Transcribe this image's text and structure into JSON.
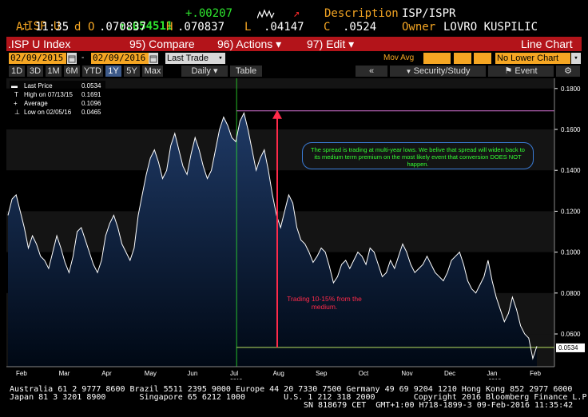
{
  "header": {
    "ticker": ".ISP U",
    "arrow_up": "↑",
    "last": ".054511",
    "change": "+.00207",
    "description_label": "Description",
    "description_value": "ISP/ISPR",
    "at_label": "At",
    "time": "11:35",
    "d_label": "d",
    "open_label": "O",
    "open": ".070837",
    "high_label": "H",
    "high": ".070837",
    "low_label": "L",
    "low": ".04147",
    "close_label": "C",
    "close": ".0524",
    "owner_label": "Owner",
    "owner": "LOVRO KUSPILIC"
  },
  "toolbar": {
    "index_label": ".ISP U Index",
    "compare": "95) Compare",
    "actions": "96) Actions ▾",
    "edit": "97) Edit ▾",
    "chart_type": "Line Chart"
  },
  "controls": {
    "start_date": "02/09/2015",
    "end_date": "02/09/2016",
    "dash": "-",
    "field": "Last Trade",
    "mov_avg": "Mov Avg",
    "lower_chart": "No Lower Chart",
    "periods": [
      "1D",
      "3D",
      "1M",
      "6M",
      "YTD",
      "1Y",
      "5Y",
      "Max"
    ],
    "selected_period": "1Y",
    "frequency": "Daily ▾",
    "table": "Table",
    "security_study": "Security/Study",
    "event": "Event",
    "back_icon": "«"
  },
  "legend": {
    "last_price_label": "Last Price",
    "last_price": "0.0534",
    "high_label": "High on 07/13/15",
    "high": "0.1691",
    "average_label": "Average",
    "average": "0.1096",
    "low_label": "Low on 02/05/16",
    "low": "0.0465"
  },
  "annotations": {
    "comment": "The spread is trading at multi-year lows. We belive that spread will widen back to its medium term  premium on the most likely event that conversion DOES NOT happen.",
    "arrow_note": "Trading 10-15% from the medium."
  },
  "footer": {
    "line1": "Australia 61 2 9777 8600 Brazil 5511 2395 9000 Europe 44 20 7330 7500 Germany 49 69 9204 1210 Hong Kong 852 2977 6000",
    "line2": "Japan 81 3 3201 8900       Singapore 65 6212 1000        U.S. 1 212 318 2000        Copyright 2016 Bloomberg Finance L.P.",
    "line3": "SN 818679 CET  GMT+1:00 H718-1899-3 09-Feb-2016 11:35:42"
  },
  "colors": {
    "accent_orange": "#f5a623",
    "toolbar_red": "#b3141a",
    "line": "#ffffff",
    "area_top": "#1f3a66",
    "reference_high": "#d070d0",
    "reference_low": "#b8e060",
    "arrow": "#ff2a4a",
    "comment_text": "#33ff33"
  },
  "chart_data": {
    "type": "area",
    "ylim": [
      0.044,
      0.185
    ],
    "yticks": [
      0.06,
      0.08,
      0.1,
      0.12,
      0.14,
      0.16,
      0.18
    ],
    "ytick_labels": [
      "0.0600",
      "0.0800",
      "0.1000",
      "0.1200",
      "0.1400",
      "0.1600",
      "0.1800"
    ],
    "last_value_label": "0.0534",
    "xtick_labels": [
      "Feb",
      "Mar",
      "Apr",
      "May",
      "Jun",
      "Jul",
      "Aug",
      "Sep",
      "Oct",
      "Nov",
      "Dec",
      "Jan",
      "Feb"
    ],
    "year_labels": [
      "2015",
      "2016"
    ],
    "high_line": 0.1691,
    "low_line": 0.0534,
    "series": [
      {
        "values": [
          0.118,
          0.126,
          0.128,
          0.12,
          0.112,
          0.102,
          0.108,
          0.104,
          0.098,
          0.096,
          0.092,
          0.1,
          0.108,
          0.102,
          0.095,
          0.09,
          0.098,
          0.11,
          0.112,
          0.106,
          0.1,
          0.094,
          0.09,
          0.096,
          0.108,
          0.114,
          0.118,
          0.112,
          0.104,
          0.1,
          0.096,
          0.102,
          0.118,
          0.128,
          0.138,
          0.146,
          0.15,
          0.144,
          0.136,
          0.14,
          0.152,
          0.158,
          0.15,
          0.142,
          0.138,
          0.148,
          0.156,
          0.15,
          0.142,
          0.136,
          0.14,
          0.15,
          0.16,
          0.166,
          0.162,
          0.156,
          0.154,
          0.164,
          0.168,
          0.16,
          0.15,
          0.14,
          0.146,
          0.15,
          0.14,
          0.128,
          0.118,
          0.112,
          0.12,
          0.128,
          0.124,
          0.112,
          0.106,
          0.104,
          0.1,
          0.095,
          0.098,
          0.102,
          0.1,
          0.093,
          0.085,
          0.088,
          0.094,
          0.096,
          0.092,
          0.096,
          0.1,
          0.098,
          0.094,
          0.102,
          0.1,
          0.094,
          0.088,
          0.09,
          0.096,
          0.092,
          0.098,
          0.104,
          0.1,
          0.094,
          0.09,
          0.092,
          0.094,
          0.098,
          0.094,
          0.09,
          0.088,
          0.086,
          0.09,
          0.096,
          0.098,
          0.1,
          0.094,
          0.086,
          0.082,
          0.08,
          0.084,
          0.088,
          0.096,
          0.086,
          0.078,
          0.072,
          0.066,
          0.07,
          0.078,
          0.072,
          0.064,
          0.06,
          0.058,
          0.048,
          0.054
        ]
      }
    ]
  }
}
